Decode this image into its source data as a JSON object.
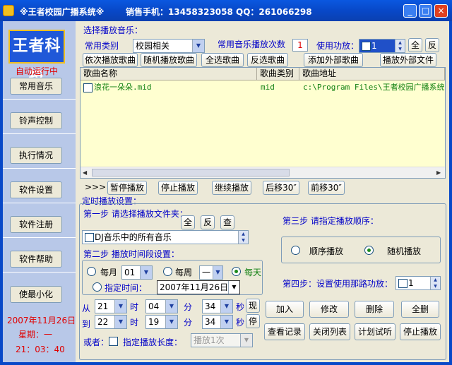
{
  "titlebar": {
    "title": "※王者校园广播系统※",
    "info": "销售手机：13458323058 QQ：261066298",
    "min": "_",
    "max": "□",
    "close": "×"
  },
  "left": {
    "logo": "王者科技",
    "auto_run": "自动运行中",
    "nav": [
      "常用音乐",
      "铃声控制",
      "执行情况",
      "软件设置",
      "软件注册",
      "软件帮助",
      "使最小化"
    ],
    "date": "2007年11月26日",
    "weekday": "星期：一",
    "time": "21：03：40"
  },
  "select_music": {
    "title": "选择播放音乐：",
    "category_label": "常用类别",
    "category_value": "校园相关",
    "times_label": "常用音乐播放次数",
    "times_value": "1",
    "amp_label": "使用功放：",
    "amp_value": "1",
    "all_btn": "全",
    "invert_btn": "反"
  },
  "toolbar": [
    "依次播放歌曲",
    "随机播放歌曲",
    "全选歌曲",
    "反选歌曲",
    "添加外部歌曲",
    "播放外部文件"
  ],
  "list": {
    "headers": [
      "歌曲名称",
      "歌曲类别",
      "歌曲地址"
    ],
    "rows": [
      {
        "name": "浪花一朵朵.mid",
        "category": "mid",
        "path": "c:\\Program Files\\王者校园广播系统"
      }
    ]
  },
  "playbar": {
    "arrows": ">>>",
    "buttons": [
      "暂停播放",
      "停止播放",
      "继续播放",
      "后移30″",
      "前移30″"
    ]
  },
  "schedule": {
    "title": "定时播放设置：",
    "step1": "第一步 请选择播放文件夹：",
    "step1_all": "全",
    "step1_inv": "反",
    "step1_query": "查",
    "folder_value": "DJ音乐中的所有音乐",
    "step2": "第二步 播放时间段设置：",
    "monthly": "每月",
    "month_day": "01",
    "weekly": "每周",
    "week_day": "一",
    "daily": "每天",
    "specific": "指定时间：",
    "specific_date": "2007年11月26日",
    "step3": "第三步 请指定播放顺序：",
    "order_seq": "顺序播放",
    "order_rand": "随机播放",
    "step4": "第四步：设置使用那路功放：",
    "step4_value": "1",
    "from": "从",
    "to": "到",
    "from_h": "21",
    "from_m": "04",
    "from_s": "34",
    "to_h": "22",
    "to_m": "19",
    "to_s": "34",
    "hour": "时",
    "minute": "分",
    "second": "秒",
    "now": "现",
    "stop": "停",
    "or": "或者：",
    "length_label": "指定播放长度：",
    "length_value": "播放1次"
  },
  "actions": [
    "加入",
    "修改",
    "删除",
    "全删",
    "查看记录",
    "关闭列表",
    "计划试听",
    "停止播放"
  ]
}
